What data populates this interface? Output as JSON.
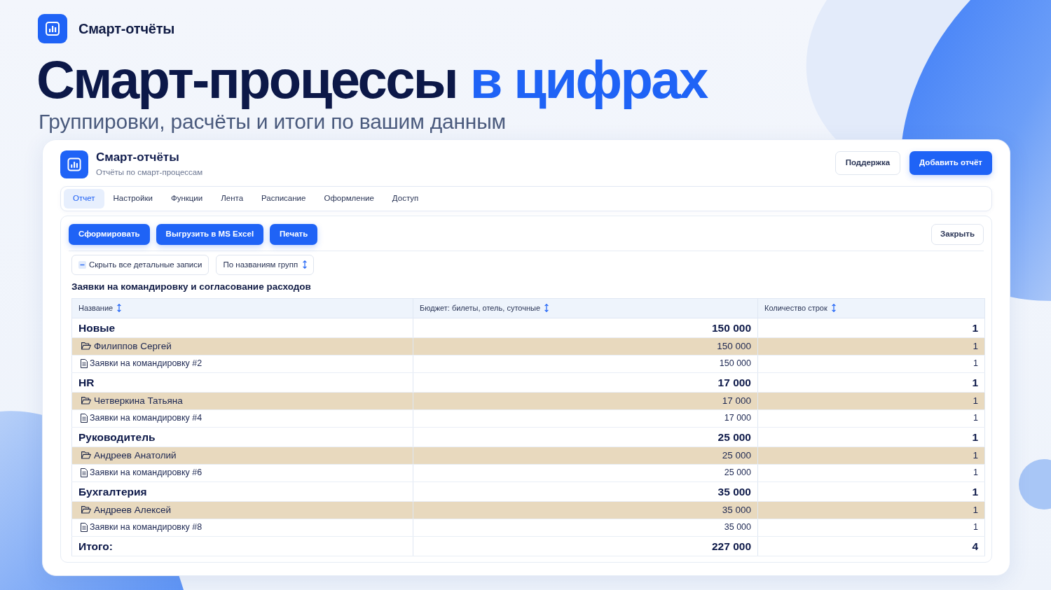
{
  "brand": {
    "name": "Смарт-отчёты"
  },
  "hero": {
    "title": "Смарт-процессы **в цифрах**",
    "subtitle": "Группировки, расчёты и итоги по вашим данным"
  },
  "app": {
    "title": "Смарт-отчёты",
    "subtitle": "Отчёты по смарт-процессам",
    "buttons": [
      {
        "label": "Поддержка",
        "kind": "secondary"
      },
      {
        "label": "Добавить отчёт",
        "kind": "primary"
      }
    ]
  },
  "tabs": [
    {
      "label": "Отчет",
      "selected": true
    },
    {
      "label": "Настройки",
      "selected": false
    },
    {
      "label": "Функции",
      "selected": false
    },
    {
      "label": "Лента",
      "selected": false
    },
    {
      "label": "Расписание",
      "selected": false
    },
    {
      "label": "Оформление",
      "selected": false
    },
    {
      "label": "Доступ",
      "selected": false
    }
  ],
  "toolbar": {
    "actions": [
      "Сформировать",
      "Выгрузить в MS Excel",
      "Печать"
    ],
    "close": "Закрыть"
  },
  "controls": [
    {
      "label": "Скрыть все детальные записи",
      "kind": "collapse"
    },
    {
      "label": "По названиям групп",
      "kind": "sort"
    }
  ],
  "report": {
    "title": "Заявки на командировку и согласование расходов",
    "columns": [
      {
        "label": "Название"
      },
      {
        "label": "Бюджет: билеты, отель, суточные"
      },
      {
        "label": "Количество строк"
      }
    ],
    "rows": [
      {
        "kind": "group",
        "cells": [
          "Новые",
          "150 000",
          "1"
        ]
      },
      {
        "kind": "person",
        "cells": [
          "Филиппов Сергей",
          "150 000",
          "1"
        ]
      },
      {
        "kind": "record",
        "cells": [
          "Заявки на командировку #2",
          "150 000",
          "1"
        ]
      },
      {
        "kind": "group",
        "cells": [
          "HR",
          "17 000",
          "1"
        ]
      },
      {
        "kind": "person",
        "cells": [
          "Четверкина Татьяна",
          "17 000",
          "1"
        ]
      },
      {
        "kind": "record",
        "cells": [
          "Заявки на командировку #4",
          "17 000",
          "1"
        ]
      },
      {
        "kind": "group",
        "cells": [
          "Руководитель",
          "25 000",
          "1"
        ]
      },
      {
        "kind": "person",
        "cells": [
          "Андреев Анатолий",
          "25 000",
          "1"
        ]
      },
      {
        "kind": "record",
        "cells": [
          "Заявки на командировку #6",
          "25 000",
          "1"
        ]
      },
      {
        "kind": "group",
        "cells": [
          "Бухгалтерия",
          "35 000",
          "1"
        ]
      },
      {
        "kind": "person",
        "cells": [
          "Андреев Алексей",
          "35 000",
          "1"
        ]
      },
      {
        "kind": "record",
        "cells": [
          "Заявки на командировку #8",
          "35 000",
          "1"
        ]
      },
      {
        "kind": "total",
        "cells": [
          "Итого:",
          "227 000",
          "4"
        ]
      }
    ]
  }
}
